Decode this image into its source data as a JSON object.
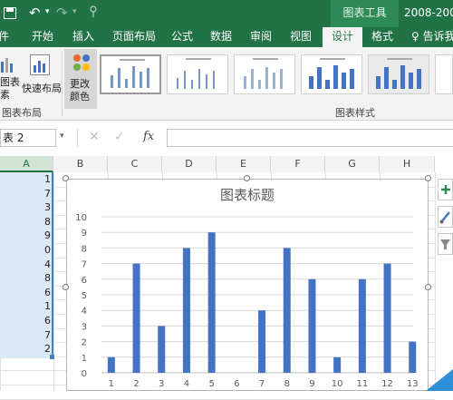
{
  "titlebar": {
    "context_tab": "图表工具",
    "document_title": "2008-2009",
    "accent_color": "#217346"
  },
  "ribbon": {
    "tabs": [
      {
        "label": "件",
        "active": false
      },
      {
        "label": "开始",
        "active": false
      },
      {
        "label": "插入",
        "active": false
      },
      {
        "label": "页面布局",
        "active": false
      },
      {
        "label": "公式",
        "active": false
      },
      {
        "label": "数据",
        "active": false
      },
      {
        "label": "审阅",
        "active": false
      },
      {
        "label": "视图",
        "active": false
      },
      {
        "label": "设计",
        "active": true
      },
      {
        "label": "格式",
        "active": false
      }
    ],
    "tell_me": "告诉我",
    "add_element_label_1": "图表",
    "add_element_label_2": "素",
    "quick_layout_label": "快速布局",
    "change_colors_label_1": "更改",
    "change_colors_label_2": "颜色",
    "group_layouts": "图表布局",
    "group_styles": "图表样式"
  },
  "formula_bar": {
    "name_box": "表 2",
    "fx": "fx",
    "formula": ""
  },
  "sheet": {
    "column_headers": [
      "A",
      "B",
      "C",
      "D",
      "E",
      "F",
      "G",
      "H"
    ],
    "column_a_values": [
      "1",
      "7",
      "3",
      "8",
      "9",
      "0",
      "4",
      "8",
      "6",
      "1",
      "6",
      "7",
      "2"
    ]
  },
  "chart_data": {
    "type": "bar",
    "title": "图表标题",
    "categories": [
      "1",
      "2",
      "3",
      "4",
      "5",
      "6",
      "7",
      "8",
      "9",
      "10",
      "11",
      "12",
      "13"
    ],
    "values": [
      1,
      7,
      3,
      8,
      9,
      0,
      4,
      8,
      6,
      1,
      6,
      7,
      2
    ],
    "ylim": [
      0,
      10
    ],
    "yticks": [
      "0",
      "1",
      "2",
      "3",
      "4",
      "5",
      "6",
      "7",
      "8",
      "9",
      "10"
    ],
    "grid": true,
    "bar_color": "#4472c4"
  }
}
